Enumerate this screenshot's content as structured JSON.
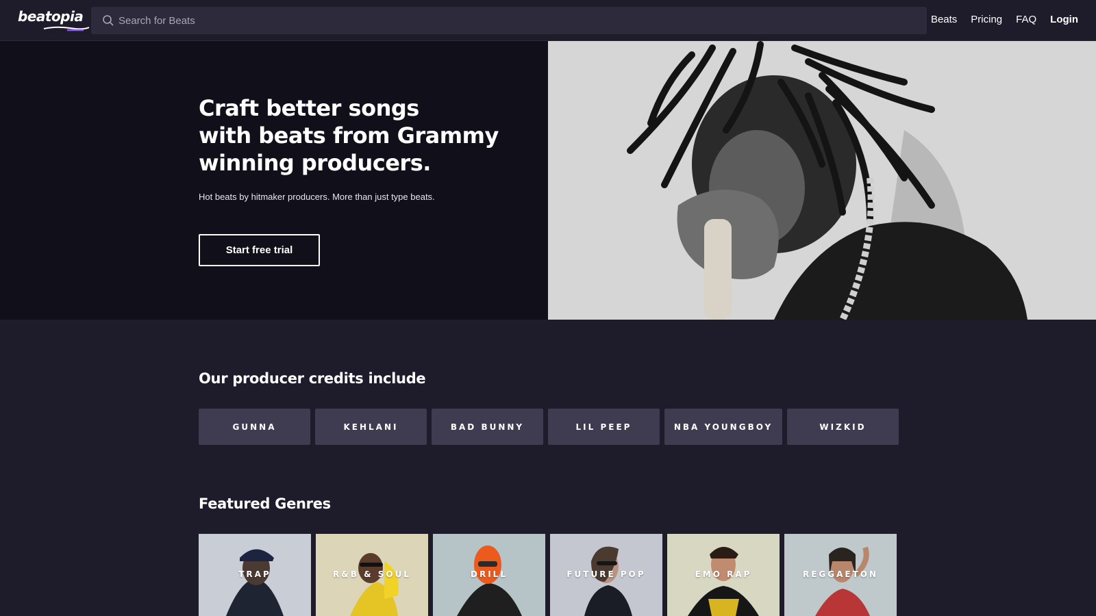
{
  "header": {
    "logo_text": "beatopia",
    "search_placeholder": "Search for Beats",
    "nav": {
      "beats": "Beats",
      "pricing": "Pricing",
      "faq": "FAQ",
      "login": "Login"
    }
  },
  "hero": {
    "title_lines": [
      "Craft better songs",
      "with beats from Grammy",
      "winning producers."
    ],
    "subtitle": "Hot beats by hitmaker producers. More than just type beats.",
    "cta_label": "Start free trial"
  },
  "credits": {
    "title": "Our producer credits include",
    "items": [
      "GUNNA",
      "KEHLANI",
      "BAD BUNNY",
      "LIL PEEP",
      "NBA YOUNGBOY",
      "WIZKID"
    ]
  },
  "genres": {
    "title": "Featured Genres",
    "items": [
      {
        "label": "TRAP",
        "bg": "#c9cdd6"
      },
      {
        "label": "R&B & SOUL",
        "bg": "#dcd5b8"
      },
      {
        "label": "DRILL",
        "bg": "#b6c3c7"
      },
      {
        "label": "FUTURE POP",
        "bg": "#c4c7cf"
      },
      {
        "label": "EMO RAP",
        "bg": "#d8d7c2"
      },
      {
        "label": "REGGAETON",
        "bg": "#bfc9cc"
      }
    ]
  },
  "colors": {
    "page_bg": "#1e1c2b",
    "hero_bg": "#110f19",
    "search_bg": "#2d2b3b",
    "credit_bg": "#3f3b51",
    "logo_accent": "#8b5cf6"
  },
  "icons": {
    "search": "search-icon",
    "logo_swoosh": "logo-swoosh-icon"
  }
}
